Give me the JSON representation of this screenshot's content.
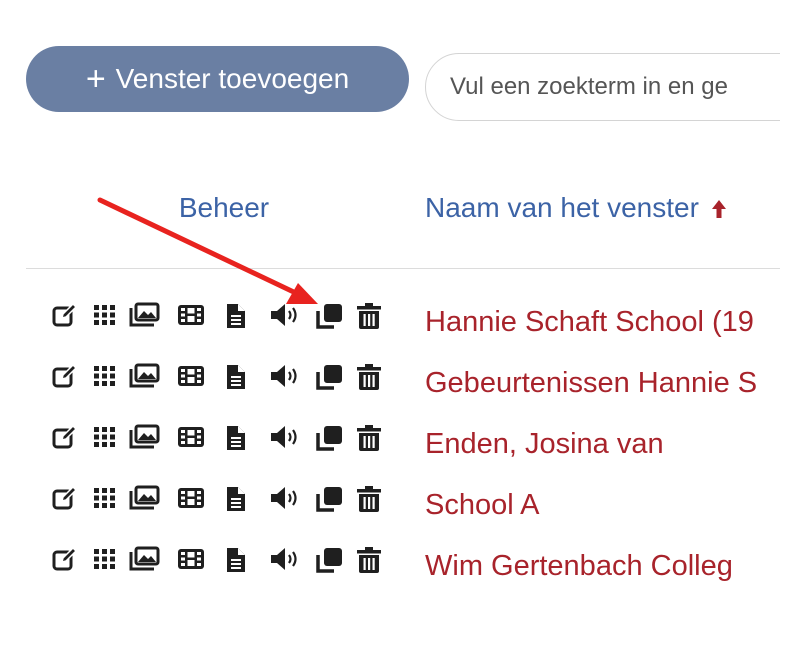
{
  "toolbar": {
    "add_plus": "+",
    "add_label": "Venster toevoegen",
    "search_placeholder": "Vul een zoekterm in en ge"
  },
  "table": {
    "columns": {
      "beheer": "Beheer",
      "name": "Naam van het venster"
    },
    "sort": {
      "column": "name",
      "direction": "ascending",
      "icon": "sort-up-arrow-icon",
      "color": "#a8232b"
    },
    "row_actions": [
      "edit-icon",
      "grid-icon",
      "images-icon",
      "film-icon",
      "file-icon",
      "volume-icon",
      "copy-icon",
      "trash-icon"
    ],
    "rows": [
      {
        "name": "Hannie Schaft School (19"
      },
      {
        "name": "Gebeurtenissen Hannie S"
      },
      {
        "name": "Enden, Josina van"
      },
      {
        "name": "School A"
      },
      {
        "name": "Wim Gertenbach Colleg"
      }
    ]
  },
  "annotation": {
    "type": "red-arrow",
    "color": "#e8231f",
    "target": "copy-icon in first row"
  },
  "colors": {
    "primary_button": "#6a7fa3",
    "header_text": "#3c63a6",
    "link_text": "#a8232b",
    "icon": "#1f1f1f"
  }
}
